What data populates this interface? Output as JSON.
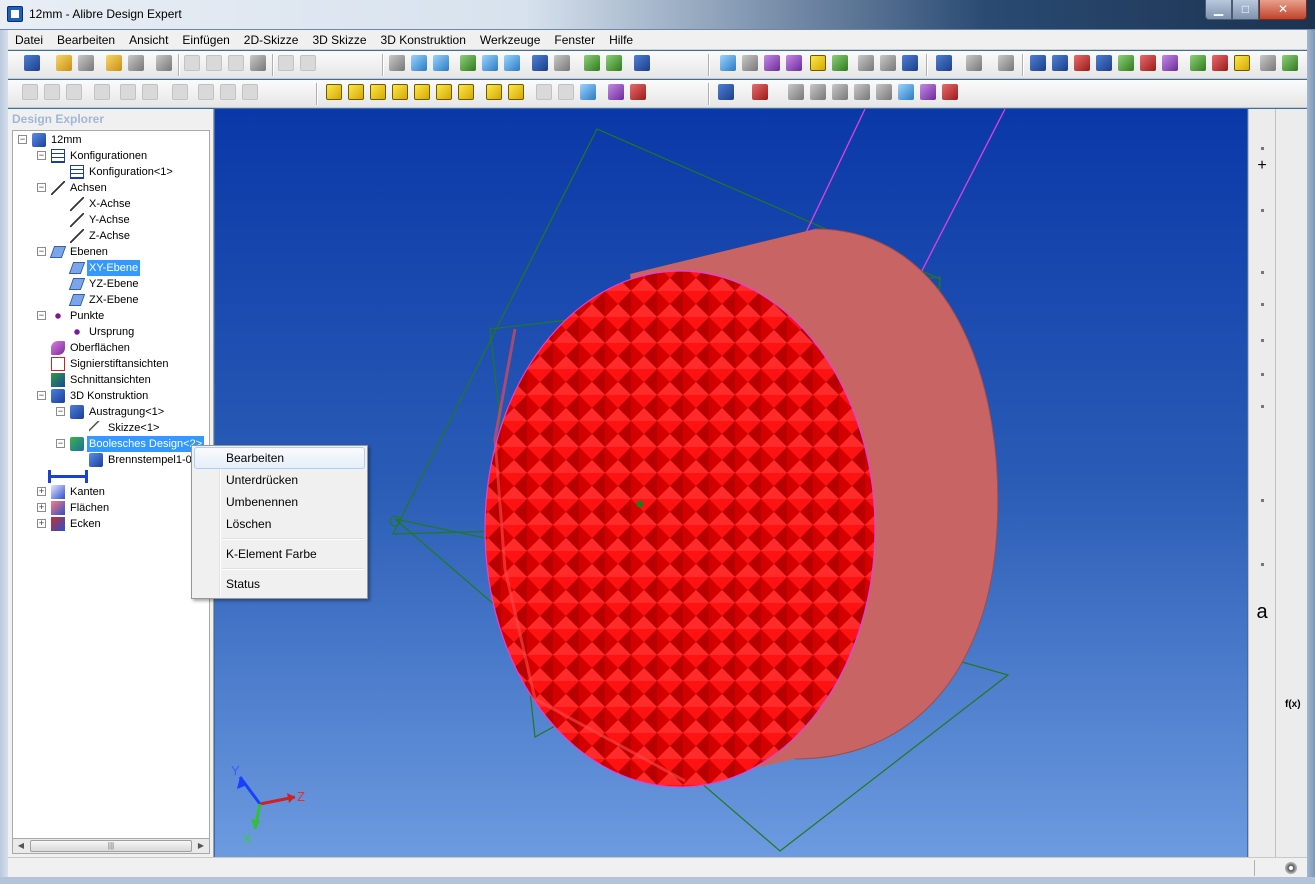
{
  "window": {
    "title": "12mm - Alibre Design Expert"
  },
  "menu": [
    "Datei",
    "Bearbeiten",
    "Ansicht",
    "Einfügen",
    "2D-Skizze",
    "3D Skizze",
    "3D Konstruktion",
    "Werkzeuge",
    "Fenster",
    "Hilfe"
  ],
  "explorer": {
    "title": "Design Explorer",
    "nodes": [
      {
        "label": "12mm",
        "icon": "part-model-icon",
        "depth": 0,
        "expander": "−"
      },
      {
        "label": "Konfigurationen",
        "icon": "configuration-table-icon",
        "depth": 1,
        "expander": "−"
      },
      {
        "label": "Konfiguration<1>",
        "icon": "configuration-table-icon",
        "depth": 2,
        "expander": ""
      },
      {
        "label": "Achsen",
        "icon": "axis-icon",
        "depth": 1,
        "expander": "−"
      },
      {
        "label": "X-Achse",
        "icon": "axis-icon",
        "depth": 2,
        "expander": ""
      },
      {
        "label": "Y-Achse",
        "icon": "axis-icon",
        "depth": 2,
        "expander": ""
      },
      {
        "label": "Z-Achse",
        "icon": "axis-icon",
        "depth": 2,
        "expander": ""
      },
      {
        "label": "Ebenen",
        "icon": "plane-icon",
        "depth": 1,
        "expander": "−"
      },
      {
        "label": "XY-Ebene",
        "icon": "plane-icon",
        "depth": 2,
        "expander": "",
        "selected": true
      },
      {
        "label": "YZ-Ebene",
        "icon": "plane-icon",
        "depth": 2,
        "expander": ""
      },
      {
        "label": "ZX-Ebene",
        "icon": "plane-icon",
        "depth": 2,
        "expander": ""
      },
      {
        "label": "Punkte",
        "icon": "point-icon",
        "depth": 1,
        "expander": "−"
      },
      {
        "label": "Ursprung",
        "icon": "point-icon",
        "depth": 2,
        "expander": ""
      },
      {
        "label": "Oberflächen",
        "icon": "surface-icon",
        "depth": 1,
        "expander": ""
      },
      {
        "label": "Signierstiftansichten",
        "icon": "signature-view-icon",
        "depth": 1,
        "expander": ""
      },
      {
        "label": "Schnittansichten",
        "icon": "section-view-icon",
        "depth": 1,
        "expander": ""
      },
      {
        "label": "3D Konstruktion",
        "icon": "feature-folder-icon",
        "depth": 1,
        "expander": "−"
      },
      {
        "label": "Austragung<1>",
        "icon": "extrude-icon",
        "depth": 2,
        "expander": "−"
      },
      {
        "label": "Skizze<1>",
        "icon": "sketch-icon",
        "depth": 3,
        "expander": ""
      },
      {
        "label": "Boolesches Design<2>",
        "icon": "boolean-design-icon",
        "depth": 2,
        "expander": "−",
        "selected": true
      },
      {
        "label": "Brennstempel1-0_",
        "icon": "part-model-icon",
        "depth": 3,
        "expander": ""
      },
      {
        "label": "",
        "icon": "rollback-bar-icon",
        "depth": 1,
        "expander": ""
      },
      {
        "label": "Kanten",
        "icon": "edges-icon",
        "depth": 1,
        "expander": "+"
      },
      {
        "label": "Flächen",
        "icon": "faces-icon",
        "depth": 1,
        "expander": "+"
      },
      {
        "label": "Ecken",
        "icon": "vertices-icon",
        "depth": 1,
        "expander": "+"
      }
    ]
  },
  "context_menu": {
    "items": [
      "Bearbeiten",
      "Unterdrücken",
      "Umbenennen",
      "Löschen",
      "K-Element Farbe",
      "Status"
    ],
    "hovered": "Bearbeiten"
  },
  "triad": {
    "x": "X",
    "y": "Y",
    "z": "Z"
  },
  "colors": {
    "knurl_face": "#ff0000",
    "cylinder_body": "#c86464",
    "plane_lines": "#1f7a1f",
    "axis_lines": "#e040e0",
    "viewport_top": "#0a38a8",
    "viewport_bottom": "#6d9be0"
  }
}
